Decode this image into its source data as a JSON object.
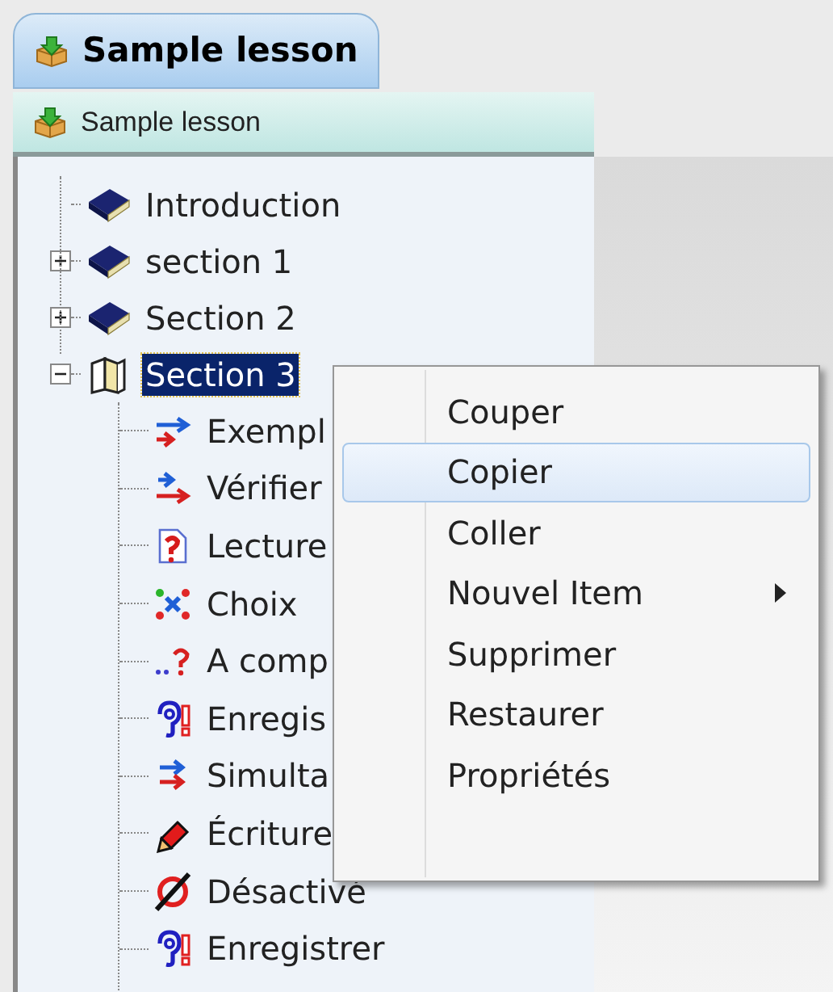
{
  "tab": {
    "label": "Sample lesson"
  },
  "lesson_bar": {
    "label": "Sample lesson"
  },
  "tree": [
    {
      "label": "Introduction",
      "kind": "book",
      "selected": false
    },
    {
      "label": "section 1",
      "kind": "book",
      "selected": false,
      "expanded": false
    },
    {
      "label": "Section 2",
      "kind": "book",
      "selected": false,
      "expanded": false
    },
    {
      "label": "Section 3",
      "kind": "open-book",
      "selected": true,
      "expanded": true,
      "children": [
        {
          "label": "Exempl",
          "kind": "arrows-example",
          "selected": false
        },
        {
          "label": "Vérifier",
          "kind": "arrows-check",
          "selected": false
        },
        {
          "label": "Lecture",
          "kind": "question-doc",
          "selected": false
        },
        {
          "label": "Choix",
          "kind": "choice",
          "selected": false
        },
        {
          "label": "A comp",
          "kind": "fill-blank",
          "selected": false
        },
        {
          "label": "Enregis",
          "kind": "ear",
          "selected": false
        },
        {
          "label": "Simulta",
          "kind": "arrows-double",
          "selected": false
        },
        {
          "label": "Écriture",
          "kind": "pencil",
          "selected": false
        },
        {
          "label": "Désactivé",
          "kind": "disabled",
          "selected": false
        },
        {
          "label": "Enregistrer",
          "kind": "ear",
          "selected": false
        }
      ]
    }
  ],
  "context_menu": [
    {
      "label": "Couper",
      "selected": false
    },
    {
      "label": "Copier",
      "selected": true
    },
    {
      "label": "Coller",
      "selected": false
    },
    {
      "label": "Nouvel Item",
      "selected": false,
      "submenu": true
    },
    {
      "label": "Supprimer",
      "selected": false
    },
    {
      "label": "Restaurer",
      "selected": false
    },
    {
      "label": "Propriétés",
      "selected": false
    }
  ]
}
